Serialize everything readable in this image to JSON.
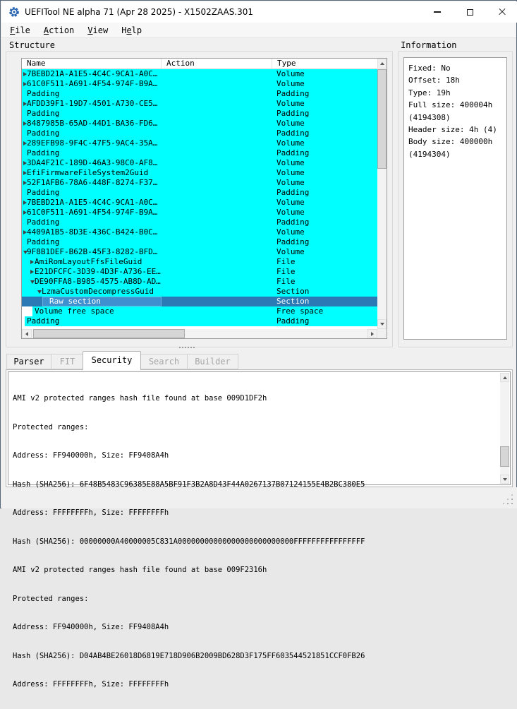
{
  "window": {
    "title": "UEFITool NE alpha 71 (Apr 28 2025) - X1502ZAAS.301"
  },
  "menu": {
    "file": {
      "pre": "",
      "key": "F",
      "post": "ile"
    },
    "action": {
      "pre": "",
      "key": "A",
      "post": "ction"
    },
    "view": {
      "pre": "",
      "key": "V",
      "post": "iew"
    },
    "help": {
      "pre": "H",
      "key": "e",
      "post": "lp"
    }
  },
  "structure": {
    "label": "Structure",
    "columns": [
      "Name",
      "Action",
      "Type"
    ],
    "rows": [
      {
        "name": "7BEBD21A-A1E5-4C4C-9CA1-A0C…",
        "type": "Volume"
      },
      {
        "name": "61C0F511-A691-4F54-974F-B9A…",
        "type": "Volume"
      },
      {
        "name": "Padding",
        "type": "Padding"
      },
      {
        "name": "AFDD39F1-19D7-4501-A730-CE5…",
        "type": "Volume"
      },
      {
        "name": "Padding",
        "type": "Padding"
      },
      {
        "name": "8487985B-65AD-44D1-BA36-FD6…",
        "type": "Volume"
      },
      {
        "name": "Padding",
        "type": "Padding"
      },
      {
        "name": "289EFB98-9F4C-47F5-9AC4-35A…",
        "type": "Volume"
      },
      {
        "name": "Padding",
        "type": "Padding"
      },
      {
        "name": "3DA4F21C-189D-46A3-98C0-AF8…",
        "type": "Volume"
      },
      {
        "name": "EfiFirmwareFileSystem2Guid",
        "type": "Volume"
      },
      {
        "name": "52F1AFB6-78A6-448F-8274-F37…",
        "type": "Volume"
      },
      {
        "name": "Padding",
        "type": "Padding"
      },
      {
        "name": "7BEBD21A-A1E5-4C4C-9CA1-A0C…",
        "type": "Volume"
      },
      {
        "name": "61C0F511-A691-4F54-974F-B9A…",
        "type": "Volume"
      },
      {
        "name": "Padding",
        "type": "Padding"
      },
      {
        "name": "4409A1B5-8D3E-436C-B424-B0C…",
        "type": "Volume"
      },
      {
        "name": "Padding",
        "type": "Padding"
      },
      {
        "name": "9F8B1DEF-B62B-45F3-8282-BFD…",
        "type": "Volume"
      },
      {
        "name": "AmiRomLayoutFfsFileGuid",
        "type": "File"
      },
      {
        "name": "E21DFCFC-3D39-4D3F-A736-EE…",
        "type": "File"
      },
      {
        "name": "DE90FFA8-B985-4575-AB8D-AD…",
        "type": "File"
      },
      {
        "name": "LzmaCustomDecompressGuid",
        "type": "Section"
      },
      {
        "name": "Raw section",
        "type": "Section"
      },
      {
        "name": "Volume free space",
        "type": "Free space"
      },
      {
        "name": "Padding",
        "type": "Padding"
      }
    ]
  },
  "information": {
    "label": "Information",
    "lines": [
      "Fixed: No",
      "Offset: 18h",
      "Type: 19h",
      "Full size: 400004h",
      "(4194308)",
      "Header size: 4h (4)",
      "Body size: 400000h",
      "(4194304)"
    ]
  },
  "tabs": [
    {
      "label": "Parser",
      "state": "enabled"
    },
    {
      "label": "FIT",
      "state": "disabled"
    },
    {
      "label": "Security",
      "state": "selected"
    },
    {
      "label": "Search",
      "state": "disabled"
    },
    {
      "label": "Builder",
      "state": "disabled"
    }
  ],
  "console": {
    "lines": [
      "AMI v2 protected ranges hash file found at base 009D1DF2h",
      "Protected ranges:",
      "Address: FF940000h, Size: FF9408A4h",
      "Hash (SHA256): 6F48B5483C96385E88A5BF91F3B2A8D43F44A0267137B07124155E4B2BC380E5",
      "Address: FFFFFFFFh, Size: FFFFFFFFh",
      "Hash (SHA256): 00000000A40000005C831A00000000000000000000000000FFFFFFFFFFFFFFFF",
      "AMI v2 protected ranges hash file found at base 009F2316h",
      "Protected ranges:",
      "Address: FF940000h, Size: FF9408A4h",
      "Hash (SHA256): D04AB4BE26018D6819E718D906B2009BD628D3F175FF603544521851CCF0FB26",
      "Address: FFFFFFFFh, Size: FFFFFFFFh"
    ]
  },
  "colors": {
    "item_highlight_cyan": "#00ffff",
    "selection_blue": "#2b7ab6",
    "selection_inner_blue": "#3f90ce",
    "window_background": "#f0f0f0"
  }
}
